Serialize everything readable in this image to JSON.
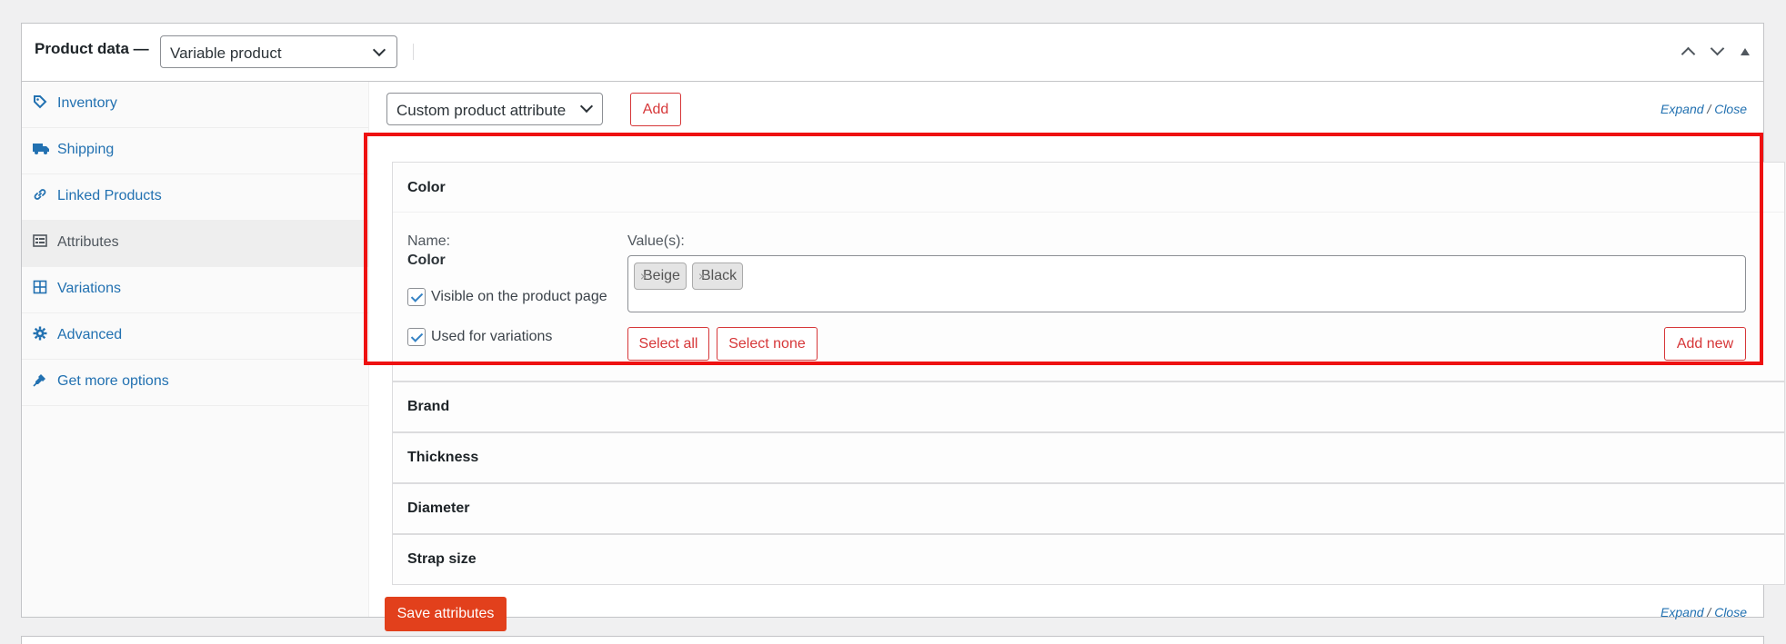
{
  "header": {
    "title": "Product data —",
    "product_type": "Variable product"
  },
  "tabs": [
    {
      "label": "Inventory",
      "icon": "tag-icon"
    },
    {
      "label": "Shipping",
      "icon": "truck-icon"
    },
    {
      "label": "Linked Products",
      "icon": "link-icon"
    },
    {
      "label": "Attributes",
      "icon": "list-icon"
    },
    {
      "label": "Variations",
      "icon": "grid-icon"
    },
    {
      "label": "Advanced",
      "icon": "gear-icon"
    },
    {
      "label": "Get more options",
      "icon": "plugin-icon"
    }
  ],
  "active_tab": "Attributes",
  "toolbar": {
    "attribute_select": "Custom product attribute",
    "add_label": "Add",
    "expand": "Expand",
    "slash": "/",
    "close": "Close"
  },
  "color_attribute": {
    "title": "Color",
    "name_label": "Name:",
    "name_value": "Color",
    "visible_label": "Visible on the product page",
    "visible_checked": true,
    "variations_label": "Used for variations",
    "variations_checked": true,
    "values_label": "Value(s):",
    "values": [
      "Beige",
      "Black"
    ],
    "select_all": "Select all",
    "select_none": "Select none",
    "add_new": "Add new"
  },
  "other_attributes": [
    "Brand",
    "Thickness",
    "Diameter",
    "Strap size"
  ],
  "footer": {
    "save_label": "Save attributes"
  },
  "colors": {
    "accent_link": "#2271b1",
    "danger": "#d63638",
    "primary_button": "#e2401c",
    "highlight": "#ee1111"
  }
}
